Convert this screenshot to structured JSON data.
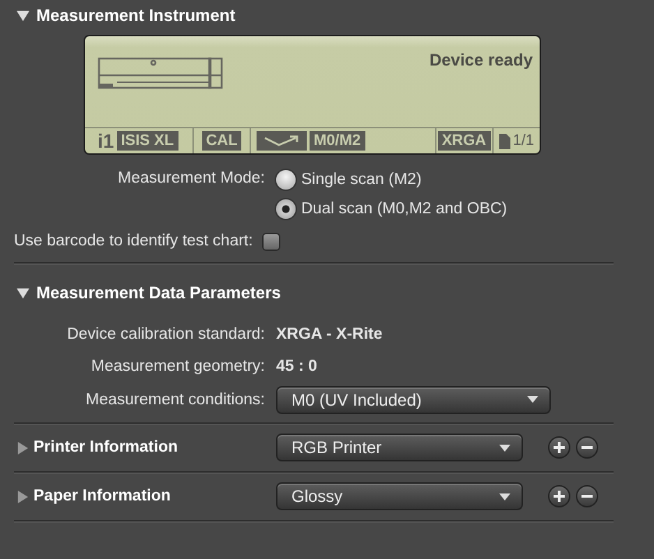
{
  "instrument": {
    "title": "Measurement Instrument",
    "expanded": true,
    "lcd": {
      "status": "Device ready",
      "segments": [
        {
          "kind": "logo",
          "text": "i1",
          "value": "ISIS XL"
        },
        {
          "kind": "plain",
          "value": "CAL"
        },
        {
          "kind": "mode",
          "value": "M0/M2"
        },
        {
          "kind": "plain",
          "value": "XRGA"
        },
        {
          "kind": "page",
          "value": "1/1"
        }
      ]
    },
    "mode": {
      "label": "Measurement Mode:",
      "options": [
        {
          "label": "Single scan (M2)",
          "selected": false
        },
        {
          "label": "Dual scan (M0,M2 and OBC)",
          "selected": true
        }
      ]
    },
    "barcode": {
      "label": "Use barcode to identify test chart:",
      "checked": false
    }
  },
  "data_parameters": {
    "title": "Measurement Data Parameters",
    "expanded": true,
    "rows": [
      {
        "kind": "value",
        "label": "Device calibration standard:",
        "value": "XRGA - X-Rite"
      },
      {
        "kind": "value",
        "label": "Measurement geometry:",
        "value": "45 : 0"
      },
      {
        "kind": "dropdown",
        "label": "Measurement conditions:",
        "value": "M0 (UV Included)"
      }
    ]
  },
  "collapsed_sections": [
    {
      "title": "Printer Information",
      "expanded": false,
      "value": "RGB Printer"
    },
    {
      "title": "Paper Information",
      "expanded": false,
      "value": "Glossy"
    }
  ]
}
